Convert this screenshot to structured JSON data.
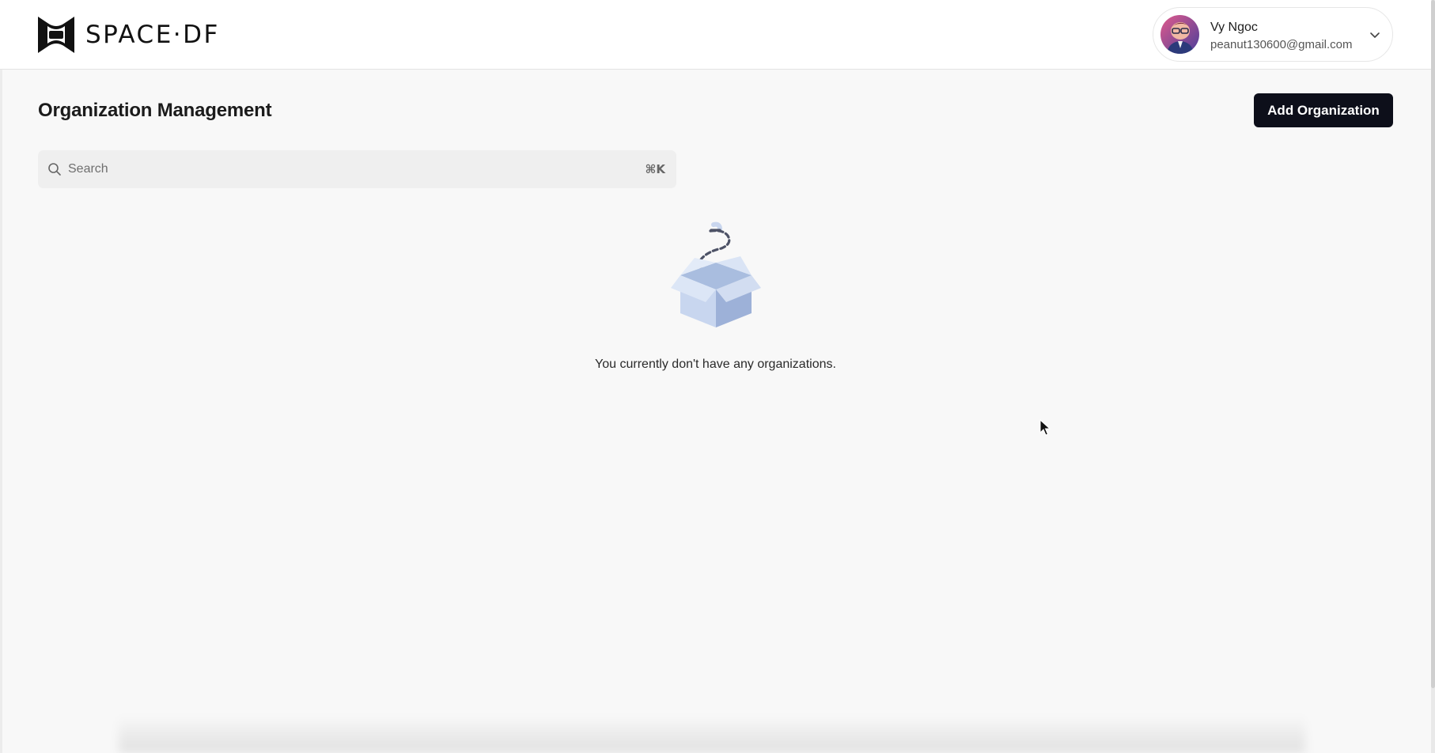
{
  "brand": {
    "name": "SPACE·DF",
    "logo_icon": "bracket-logo-icon"
  },
  "user": {
    "name": "Vy Ngoc",
    "email": "peanut130600@gmail.com",
    "menu_icon": "chevron-down-icon"
  },
  "page": {
    "title": "Organization Management",
    "add_button_label": "Add Organization"
  },
  "search": {
    "placeholder": "Search",
    "value": "",
    "shortcut": "⌘K",
    "icon": "search-icon"
  },
  "empty_state": {
    "icon": "empty-box-icon",
    "message": "You currently don't have any organizations."
  },
  "colors": {
    "primary_button": "#0d0f1a",
    "page_background": "#f8f8f8",
    "header_background": "#ffffff",
    "box_illustration": "#c5d3ea"
  }
}
